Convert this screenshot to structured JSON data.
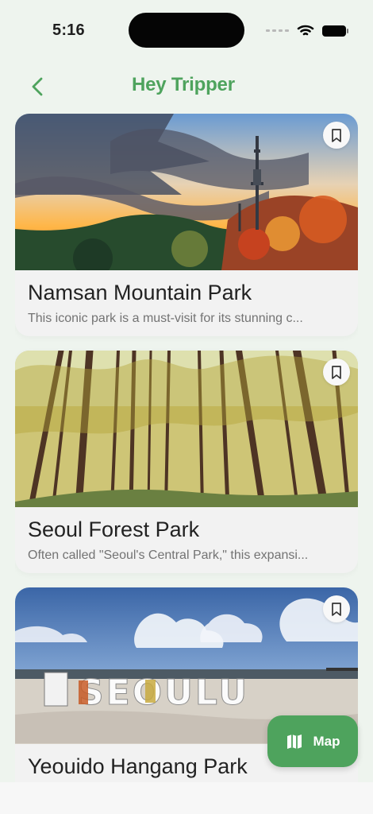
{
  "status": {
    "time": "5:16",
    "icons": [
      "cellular-signal-icon",
      "wifi-icon",
      "battery-icon"
    ]
  },
  "header": {
    "title": "Hey Tripper",
    "back_icon": "chevron-left-icon"
  },
  "places": [
    {
      "title": "Namsan Mountain Park",
      "description": "This iconic park is a must-visit for its stunning c..."
    },
    {
      "title": "Seoul Forest Park",
      "description": "Often called \"Seoul's Central Park,\" this expansi..."
    },
    {
      "title": "Yeouido Hangang Park",
      "description": ""
    }
  ],
  "sign_text": "SEOULU",
  "map_button": {
    "label": "Map",
    "icon": "map-icon"
  },
  "colors": {
    "background": "#eef4ee",
    "brand_green": "#4ea35d",
    "card": "#f2f2f2"
  }
}
